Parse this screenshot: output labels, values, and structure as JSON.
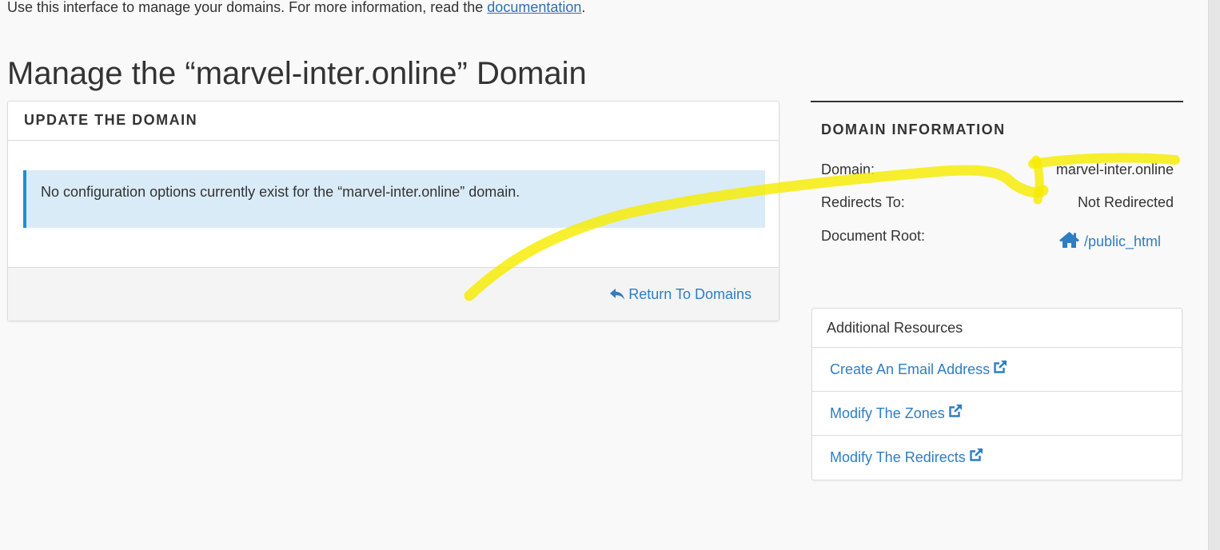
{
  "intro": {
    "text": "Use this interface to manage your domains. For more information, read the ",
    "link_label": "documentation",
    "suffix": "."
  },
  "page": {
    "title": "Manage the “marvel-inter.online” Domain"
  },
  "update_panel": {
    "heading": "UPDATE THE DOMAIN",
    "alert": "No configuration options currently exist for the “marvel-inter.online” domain.",
    "return_label": "Return To Domains",
    "return_icon": "reply-icon"
  },
  "domain_info": {
    "title": "DOMAIN INFORMATION",
    "rows": [
      {
        "label": "Domain:",
        "value": "marvel-inter.online"
      },
      {
        "label": "Redirects To:",
        "value": "Not Redirected"
      },
      {
        "label": "Document Root:",
        "value": "/public_html",
        "icon": "home-icon"
      }
    ]
  },
  "resources": {
    "heading": "Additional Resources",
    "items": [
      {
        "label": "Create An Email Address",
        "icon": "external-link-icon"
      },
      {
        "label": "Modify The Zones",
        "icon": "external-link-icon"
      },
      {
        "label": "Modify The Redirects",
        "icon": "external-link-icon"
      }
    ]
  },
  "colors": {
    "link": "#2f7dc3",
    "alert_bg": "#d9ebf7",
    "alert_border": "#1f8ed6",
    "highlighter": "#f7ec00"
  }
}
